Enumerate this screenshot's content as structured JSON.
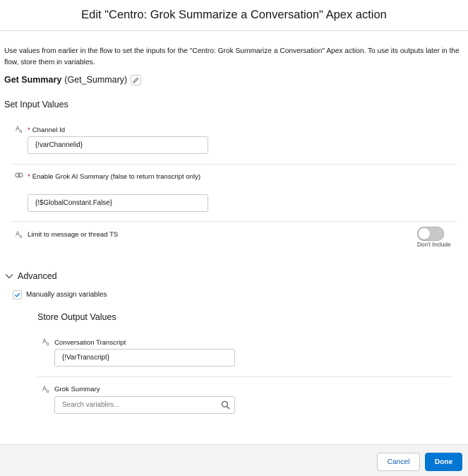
{
  "header": {
    "title": "Edit \"Centro: Grok Summarize a Conversation\" Apex action"
  },
  "intro": "Use values from earlier in the flow to set the inputs for the \"Centro: Grok Summarize a Conversation\" Apex action. To use its outputs later in the flow, store them in variables.",
  "element": {
    "label": "Get Summary",
    "api_name": "(Get_Summary)"
  },
  "inputs": {
    "heading": "Set Input Values",
    "channel_id": {
      "icon": "text-type-icon",
      "label": "Channel Id",
      "value": "{!varChannelid}"
    },
    "enable_grok": {
      "icon": "boolean-type-icon",
      "label": "Enable Grok AI Summary (false to return transcript only)",
      "value": "{!$GlobalConstant.False}"
    },
    "limit_ts": {
      "icon": "text-type-icon",
      "label": "Limit to message or thread TS",
      "toggle_caption": "Don't Include",
      "included": false
    }
  },
  "advanced": {
    "label": "Advanced",
    "manual_assign_label": "Manually assign variables",
    "manual_assign_checked": true
  },
  "outputs": {
    "heading": "Store Output Values",
    "transcript": {
      "label": "Conversation Transcript",
      "value": "{!VarTranscript}"
    },
    "grok_summary": {
      "label": "Grok Summary",
      "placeholder": "Search variables..."
    }
  },
  "footer": {
    "cancel_label": "Cancel",
    "done_label": "Done"
  },
  "colors": {
    "brand": "#0176d3",
    "link": "#0b5cab",
    "required": "#ba0517"
  }
}
